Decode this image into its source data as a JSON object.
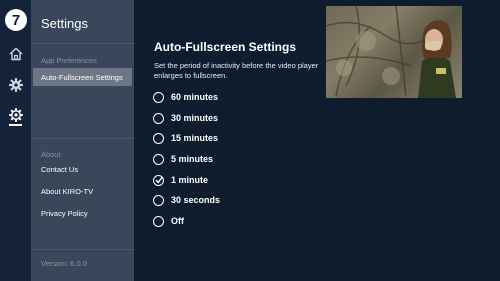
{
  "rail": {
    "logo_text": "7",
    "icons": [
      "home-icon",
      "settings-gear-icon",
      "preferences-gear-icon"
    ]
  },
  "sidebar": {
    "title": "Settings",
    "section_app": "App Preferences",
    "active_item": "Auto-Fullscreen Settings",
    "section_about": "About",
    "items": [
      "Contact Us",
      "About KIRO-TV",
      "Privacy Policy"
    ],
    "version": "Version: 6.0.0"
  },
  "main": {
    "heading": "Auto-Fullscreen Settings",
    "description": "Set the period of inactivity before the video player enlarges to fullscreen.",
    "options": [
      "60 minutes",
      "30 minutes",
      "15 minutes",
      "5 minutes",
      "1 minute",
      "30 seconds",
      "Off"
    ],
    "selected": "1 minute"
  },
  "colors": {
    "background": "#0f1c2e",
    "sidebar": "#3a465a",
    "active_item": "#6d7685",
    "rail": "#14223a"
  }
}
